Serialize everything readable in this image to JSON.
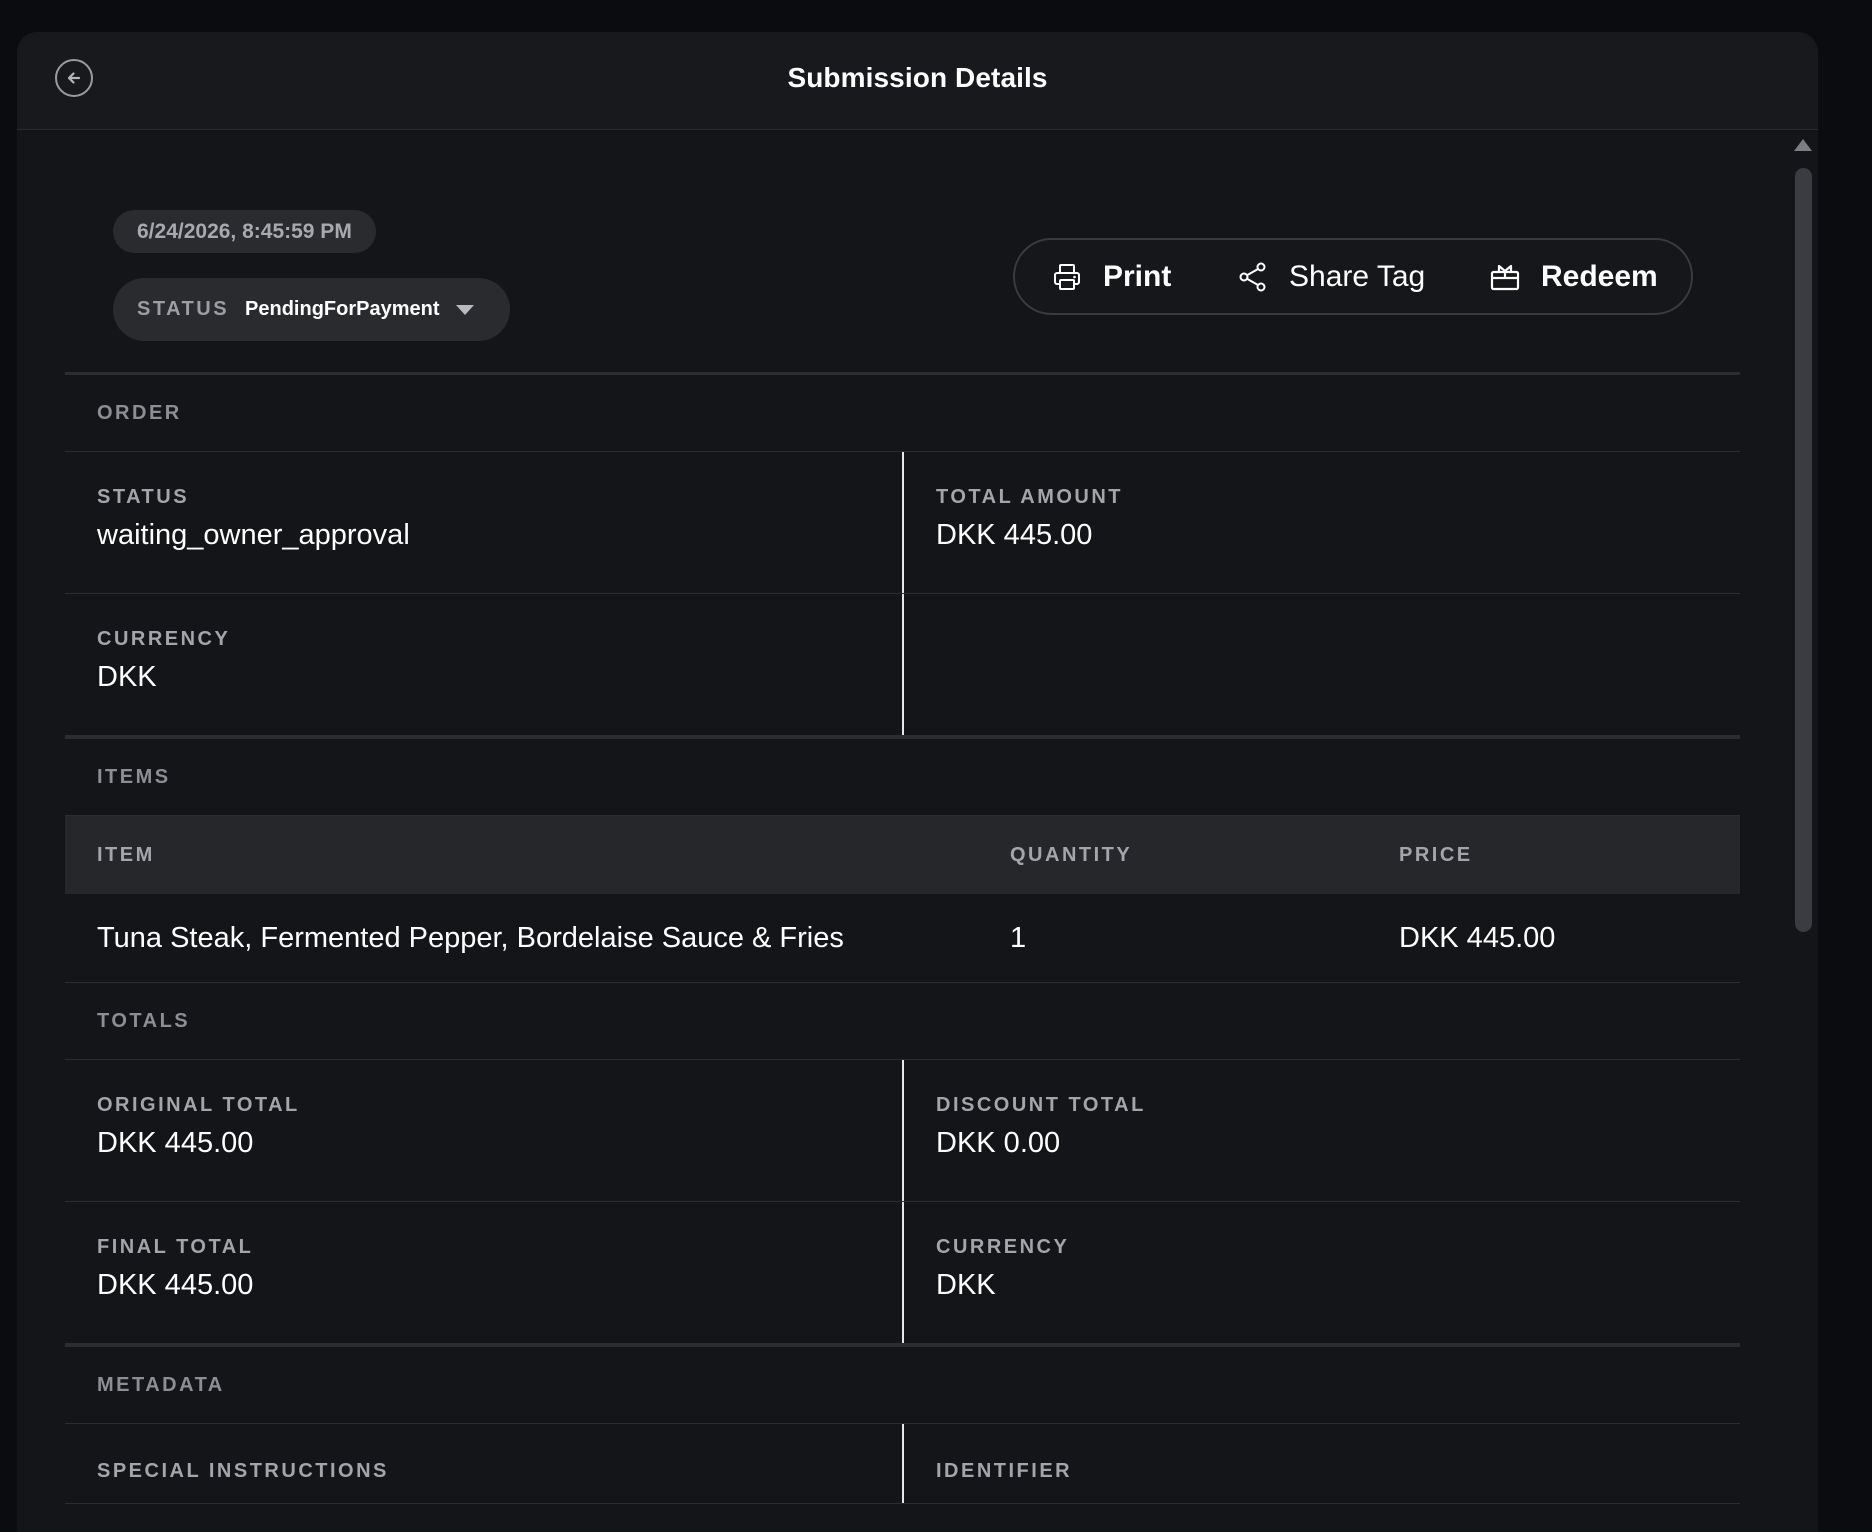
{
  "header": {
    "title": "Submission Details",
    "back_icon": "arrow-left-circle-icon"
  },
  "meta": {
    "timestamp": "6/24/2026, 8:45:59 PM",
    "status_label": "STATUS",
    "status_value": "PendingForPayment"
  },
  "actions": {
    "print": "Print",
    "share": "Share Tag",
    "redeem": "Redeem"
  },
  "order": {
    "heading": "ORDER",
    "status_label": "STATUS",
    "status_value": "waiting_owner_approval",
    "total_label": "TOTAL AMOUNT",
    "total_value": "DKK 445.00",
    "currency_label": "CURRENCY",
    "currency_value": "DKK"
  },
  "items": {
    "heading": "ITEMS",
    "columns": [
      "ITEM",
      "QUANTITY",
      "PRICE"
    ],
    "rows": [
      {
        "item": "Tuna Steak, Fermented Pepper, Bordelaise Sauce & Fries",
        "quantity": "1",
        "price": "DKK 445.00"
      }
    ]
  },
  "totals": {
    "heading": "TOTALS",
    "original_label": "ORIGINAL TOTAL",
    "original_value": "DKK 445.00",
    "discount_label": "DISCOUNT TOTAL",
    "discount_value": "DKK 0.00",
    "final_label": "FINAL TOTAL",
    "final_value": "DKK 445.00",
    "currency_label": "CURRENCY",
    "currency_value": "DKK"
  },
  "metadata": {
    "heading": "METADATA",
    "special_label": "SPECIAL INSTRUCTIONS",
    "identifier_label": "IDENTIFIER"
  }
}
